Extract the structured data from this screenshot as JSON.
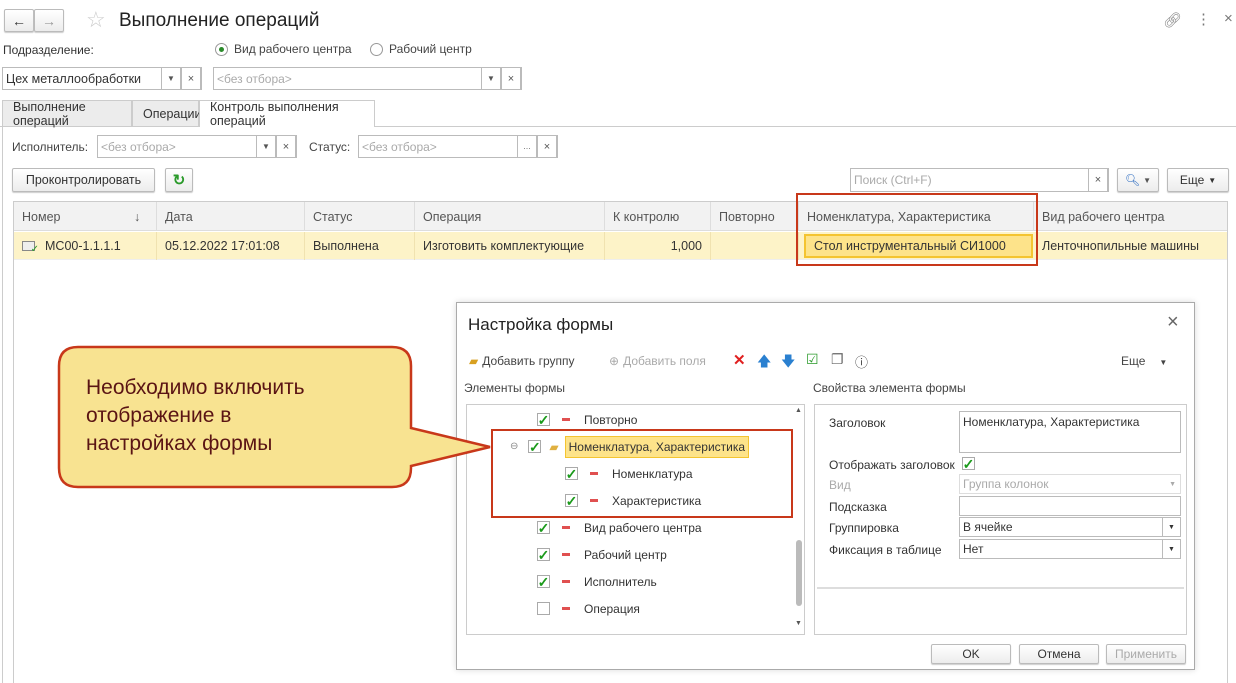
{
  "window": {
    "title": "Выполнение операций",
    "back": "←",
    "forward": "→"
  },
  "filters": {
    "subdivision_label": "Подразделение:",
    "subdivision_value": "Цех металлообработки",
    "radio1": "Вид рабочего центра",
    "radio2": "Рабочий центр",
    "radio_selected": "Вид рабочего центра",
    "wc_placeholder": "<без отбора>"
  },
  "tabs": [
    {
      "label": "Выполнение операций"
    },
    {
      "label": "Операции"
    },
    {
      "label": "Контроль выполнения операций",
      "active": true
    }
  ],
  "subfilters": {
    "executor_label": "Исполнитель:",
    "executor_placeholder": "<без отбора>",
    "status_label": "Статус:",
    "status_placeholder": "<без отбора>"
  },
  "toolbar": {
    "control_button": "Проконтролировать",
    "search_placeholder": "Поиск (Ctrl+F)",
    "more": "Еще"
  },
  "table": {
    "columns": [
      "Номер",
      "Дата",
      "Статус",
      "Операция",
      "К контролю",
      "Повторно",
      "Номенклатура, Характеристика",
      "Вид рабочего центра"
    ],
    "rows": [
      [
        "МС00-1.1.1.1",
        "05.12.2022 17:01:08",
        "Выполнена",
        "Изготовить комплектующие",
        "1,000",
        "",
        "Стол инструментальный СИ1000",
        "Ленточнопильные машины"
      ]
    ],
    "sort_icon": "↓"
  },
  "callout": {
    "text_line1": "Необходимо включить",
    "text_line2": "отображение в",
    "text_line3": "настройках формы"
  },
  "dialog": {
    "title": "Настройка формы",
    "add_group": "Добавить группу",
    "add_fields": "Добавить поля",
    "more": "Еще",
    "elements_title": "Элементы формы",
    "props_title": "Свойства элемента формы",
    "tree": [
      {
        "label": "Повторно",
        "checked": true
      },
      {
        "label": "Номенклатура, Характеристика",
        "checked": true,
        "group": true
      },
      {
        "label": "Номенклатура",
        "checked": true
      },
      {
        "label": "Характеристика",
        "checked": true
      },
      {
        "label": "Вид рабочего центра",
        "checked": true
      },
      {
        "label": "Рабочий центр",
        "checked": true
      },
      {
        "label": "Исполнитель",
        "checked": true
      },
      {
        "label": "Операция",
        "checked": false
      }
    ],
    "props": {
      "caption_label": "Заголовок",
      "caption_value": "Номенклатура, Характеристика",
      "show_caption_label": "Отображать заголовок",
      "show_caption": true,
      "kind_label": "Вид",
      "kind_value": "Группа колонок",
      "hint_label": "Подсказка",
      "hint_value": "",
      "grouping_label": "Группировка",
      "grouping_value": "В ячейке",
      "fix_label": "Фиксация в таблице",
      "fix_value": "Нет"
    },
    "ok": "OK",
    "cancel": "Отмена",
    "apply": "Применить"
  },
  "colors": {
    "highlight_border": "#c8381a",
    "selected_row": "#fdf3c8",
    "callout_fill": "#f8e391"
  }
}
